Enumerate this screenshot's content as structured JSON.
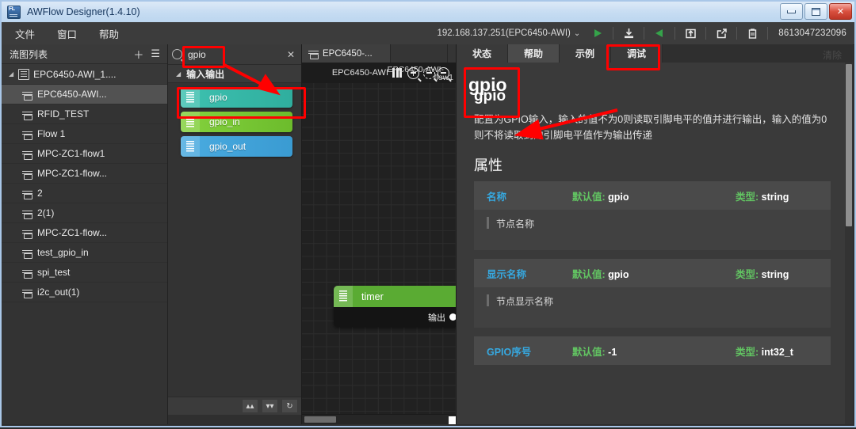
{
  "window": {
    "title": "AWFlow Designer(1.4.10)",
    "icon": "app-icon",
    "controls": {
      "minimize": "–",
      "maximize": "□",
      "close": "✕"
    }
  },
  "menubar": {
    "items": [
      {
        "label": "文件",
        "name": "menu-file"
      },
      {
        "label": "窗口",
        "name": "menu-window"
      },
      {
        "label": "帮助",
        "name": "menu-help"
      }
    ],
    "device": "192.168.137.251(EPC6450-AWI)",
    "device_caret": "⌄",
    "phone": "8613047232096",
    "tools": [
      {
        "name": "run-button",
        "glyph": "▶",
        "color": "#35a34a"
      },
      {
        "name": "download-button",
        "glyph": "download"
      },
      {
        "name": "deploy-button",
        "glyph": "◀",
        "color": "#35a34a"
      },
      {
        "name": "upload-button",
        "glyph": "upload"
      },
      {
        "name": "export-button",
        "glyph": "export"
      },
      {
        "name": "clipboard-button",
        "glyph": "clipboard"
      }
    ]
  },
  "sidebar": {
    "title": "流图列表",
    "add_label": "＋",
    "list_label": "☰",
    "root": {
      "label": "EPC6450-AWI_1....",
      "twisty": "◢"
    },
    "items": [
      {
        "label": "EPC6450-AWI...",
        "selected": true
      },
      {
        "label": "RFID_TEST",
        "selected": false
      },
      {
        "label": "Flow 1",
        "selected": false
      },
      {
        "label": "MPC-ZC1-flow1",
        "selected": false
      },
      {
        "label": "MPC-ZC1-flow...",
        "selected": false
      },
      {
        "label": "2",
        "selected": false
      },
      {
        "label": "2(1)",
        "selected": false
      },
      {
        "label": "MPC-ZC1-flow...",
        "selected": false
      },
      {
        "label": "test_gpio_in",
        "selected": false
      },
      {
        "label": "spi_test",
        "selected": false
      },
      {
        "label": "i2c_out(1)",
        "selected": false
      }
    ]
  },
  "palette": {
    "search": {
      "value": "gpio",
      "placeholder": "",
      "clear": "✕"
    },
    "category": {
      "label": "输入输出",
      "twisty": "◢"
    },
    "nodes": [
      {
        "label": "gpio",
        "color": "#3ec1b0",
        "color2": "#2fae9e",
        "highlighted": true
      },
      {
        "label": "gpio_in",
        "color": "#84d13d",
        "color2": "#6cbc2c",
        "highlighted": false
      },
      {
        "label": "gpio_out",
        "color": "#4aabe0",
        "color2": "#3a9bd2",
        "highlighted": false
      }
    ],
    "footer": [
      {
        "name": "collapse-all-button",
        "glyph": "▴▴"
      },
      {
        "name": "expand-all-button",
        "glyph": "▾▾"
      },
      {
        "name": "refresh-button",
        "glyph": "↻"
      }
    ]
  },
  "canvas": {
    "tabs": [
      {
        "label": "EPC6450-...",
        "active": true
      },
      {
        "label": "",
        "active": false
      },
      {
        "label": "",
        "active": false
      }
    ],
    "header": {
      "flow_name": "EPC6450-AWI",
      "overlay_name": "EPC6450-AWI-",
      "overlay_sub": "flow1"
    },
    "nodes": [
      {
        "label": "timer",
        "output_label": "输出",
        "color": "#5aab33"
      }
    ]
  },
  "help": {
    "tabs": [
      {
        "label": "状态",
        "active": false
      },
      {
        "label": "帮助",
        "active": true
      },
      {
        "label": "示例",
        "active": false
      },
      {
        "label": "调试",
        "active": false
      }
    ],
    "clear_label": "清除",
    "badge_title": "gpio",
    "title": "gpio",
    "description": "配置为GPIO输入，输入的值不为0则读取引脚电平的值并进行输出，输入的值为0则不将读取到的引脚电平值作为输出传递",
    "section_title": "属性",
    "default_key": "默认值:",
    "type_key": "类型:",
    "attributes": [
      {
        "name": "名称",
        "default": "gpio",
        "type": "string",
        "desc": "节点名称"
      },
      {
        "name": "显示名称",
        "default": "gpio",
        "type": "string",
        "desc": "节点显示名称"
      },
      {
        "name": "GPIO序号",
        "default": "-1",
        "type": "int32_t",
        "desc": ""
      }
    ]
  },
  "colors": {
    "annotation": "#ff0000",
    "accent_blue": "#36a9e1",
    "accent_green": "#62c462"
  }
}
